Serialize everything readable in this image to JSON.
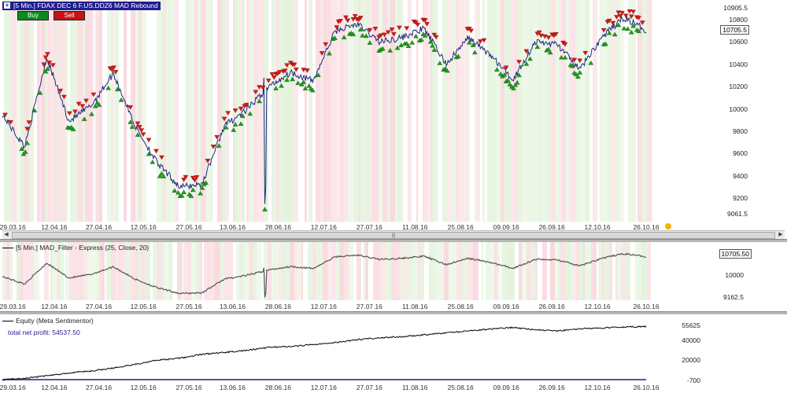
{
  "panel1": {
    "title": "[5 Min.] FDAX DEC 6    F.US.DDZ6 MAD Rebound",
    "buy_label": "Buy",
    "sell_label": "Sell",
    "last_value": "10705.5",
    "yticks": [
      "10905.5",
      "10800",
      "10600",
      "10400",
      "10200",
      "10000",
      "9800",
      "9600",
      "9400",
      "9200",
      "9061.5"
    ],
    "ylim": [
      9061.5,
      10905.5
    ]
  },
  "panel2": {
    "legend": "[5 Min.] MAD_Filter - Express  (25, Close, 20)",
    "last_value": "10705.50",
    "yticks": [
      "10000",
      "9162.5"
    ],
    "ylim": [
      9162.5,
      10900
    ]
  },
  "panel3": {
    "legend": "Equity (Meta Sentimentor)",
    "net_profit": "total net profit:  54537.50",
    "yticks": [
      "55625",
      "40000",
      "20000",
      "-700"
    ],
    "ylim": [
      -700,
      55625
    ]
  },
  "dates": [
    "29.03.16",
    "12.04.16",
    "27.04.16",
    "12.05.16",
    "27.05.16",
    "13.06.16",
    "28.06.16",
    "12.07.16",
    "27.07.16",
    "11.08.16",
    "25.08.16",
    "09.09.16",
    "26.09.16",
    "12.10.16",
    "26.10.16"
  ],
  "colors": {
    "buy": "#0c8a1e",
    "sell": "#c41414",
    "buy_marker": "#1e9e1e",
    "sell_marker": "#d61a1a",
    "title_bg": "#1f1d8f",
    "line_price": "#1a2a7a",
    "line_filter": "#555555",
    "line_equity": "#000000"
  },
  "chart_data": [
    {
      "type": "line",
      "x": [
        "29.03.16",
        "12.04.16",
        "27.04.16",
        "12.05.16",
        "27.05.16",
        "13.06.16",
        "28.06.16",
        "12.07.16",
        "27.07.16",
        "11.08.16",
        "25.08.16",
        "09.09.16",
        "26.09.16",
        "12.10.16",
        "26.10.16"
      ],
      "series": [
        {
          "name": "FDAX DEC 6",
          "values": [
            9950,
            9660,
            10460,
            9890,
            10030,
            10320,
            9840,
            9510,
            9300,
            9330,
            9850,
            9990,
            10200,
            10330,
            10250,
            10700,
            10760,
            10600,
            10640,
            10720,
            10400,
            10640,
            10480,
            10260,
            10600,
            10580,
            10350,
            10640,
            10820,
            10705.5
          ],
          "x_positions": "evenly spaced from 29.03.16 to 26.10.16"
        }
      ],
      "annotations": [
        "Buy markers (green) and Sell markers (red) along price"
      ],
      "ylim": [
        9061.5,
        10905.5
      ]
    },
    {
      "type": "line",
      "x": [
        "29.03.16",
        "12.04.16",
        "27.04.16",
        "12.05.16",
        "27.05.16",
        "13.06.16",
        "28.06.16",
        "12.07.16",
        "27.07.16",
        "11.08.16",
        "25.08.16",
        "09.09.16",
        "26.09.16",
        "12.10.16",
        "26.10.16"
      ],
      "series": [
        {
          "name": "MAD_Filter - Express (25, Close, 20)",
          "values": [
            9950,
            9660,
            10460,
            9890,
            10030,
            10320,
            9840,
            9510,
            9300,
            9330,
            9850,
            9990,
            10200,
            10330,
            10250,
            10700,
            10760,
            10600,
            10640,
            10720,
            10400,
            10640,
            10480,
            10260,
            10600,
            10580,
            10350,
            10640,
            10820,
            10705.5
          ]
        }
      ],
      "ylim": [
        9162.5,
        10900
      ]
    },
    {
      "type": "line",
      "x": [
        "29.03.16",
        "12.04.16",
        "27.04.16",
        "12.05.16",
        "27.05.16",
        "13.06.16",
        "28.06.16",
        "12.07.16",
        "27.07.16",
        "11.08.16",
        "25.08.16",
        "09.09.16",
        "26.09.16",
        "12.10.16",
        "26.10.16"
      ],
      "series": [
        {
          "name": "Equity (Meta Sentimentor)",
          "values": [
            0,
            1500,
            4000,
            7000,
            9000,
            12000,
            16000,
            20000,
            22000,
            26000,
            28000,
            30000,
            33000,
            34000,
            36000,
            38000,
            41000,
            43000,
            44000,
            46000,
            48000,
            50000,
            52000,
            53500,
            51000,
            50000,
            52000,
            53000,
            54000,
            54537.5
          ]
        }
      ],
      "ylim": [
        -700,
        55625
      ]
    }
  ]
}
